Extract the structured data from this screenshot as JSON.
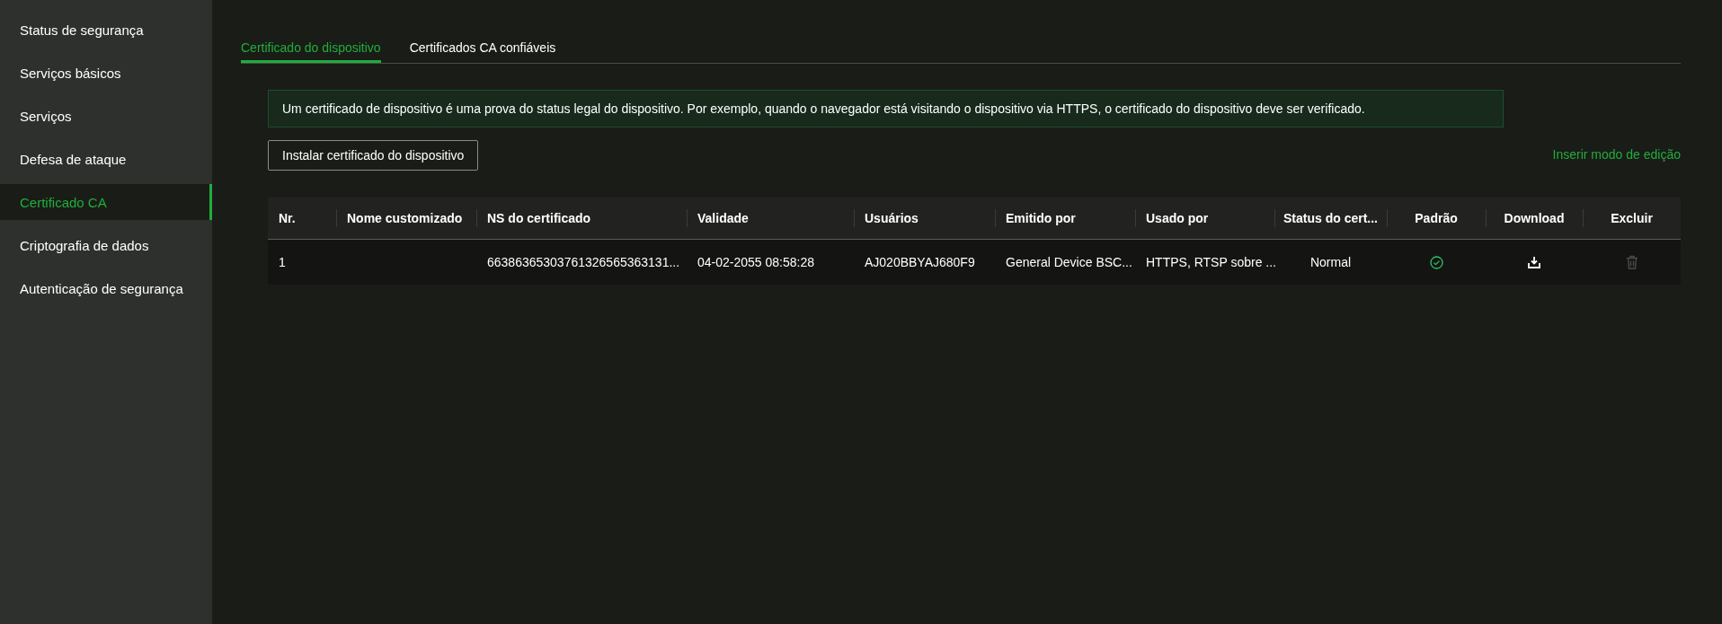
{
  "sidebar": {
    "items": [
      {
        "label": "Status de segurança",
        "selected": false
      },
      {
        "label": "Serviços básicos",
        "selected": false
      },
      {
        "label": "Serviços",
        "selected": false
      },
      {
        "label": "Defesa de ataque",
        "selected": false
      },
      {
        "label": "Certificado CA",
        "selected": true
      },
      {
        "label": "Criptografia de dados",
        "selected": false
      },
      {
        "label": "Autenticação de segurança",
        "selected": false
      }
    ]
  },
  "tabs": [
    {
      "label": "Certificado do dispositivo",
      "selected": true
    },
    {
      "label": "Certificados CA confiáveis",
      "selected": false
    }
  ],
  "info": "Um certificado de dispositivo é uma prova do status legal do dispositivo. Por exemplo, quando o navegador está visitando o dispositivo via HTTPS, o certificado do dispositivo deve ser verificado.",
  "install_button": "Instalar certificado do dispositivo",
  "edit_mode_link": "Inserir modo de edição",
  "table": {
    "columns": [
      "Nr.",
      "Nome customizado",
      "NS do certificado",
      "Validade",
      "Usuários",
      "Emitido por",
      "Usado por",
      "Status do cert...",
      "Padrão",
      "Download",
      "Excluir"
    ],
    "rows": [
      {
        "cells": [
          "1",
          "",
          "66386365303761326565363131...",
          "04-02-2055 08:58:28",
          "AJ020BBYAJ680F9",
          "General Device BSC...",
          "HTTPS, RTSP sobre ...",
          "Normal"
        ],
        "default": true,
        "delete_disabled": true
      }
    ]
  }
}
